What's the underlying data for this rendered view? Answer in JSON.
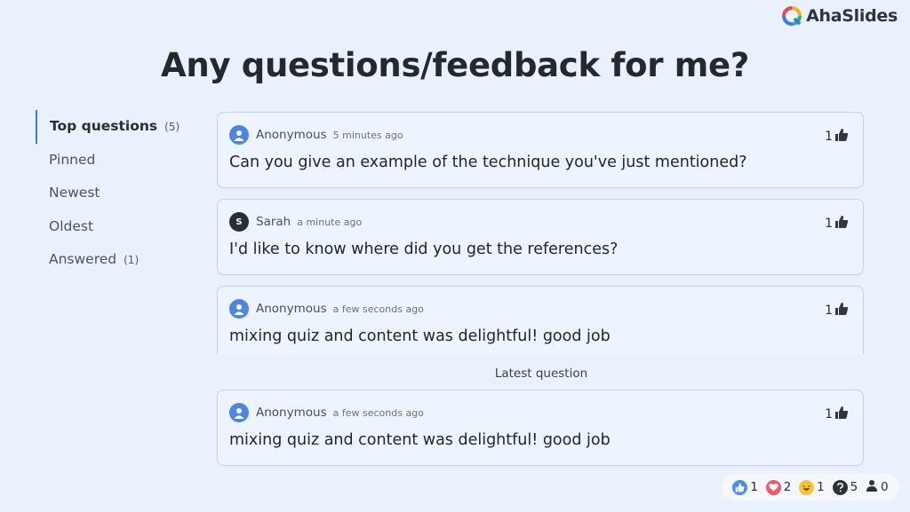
{
  "brand": {
    "name": "AhaSlides"
  },
  "title": "Any questions/feedback for me?",
  "sidebar": {
    "items": [
      {
        "label": "Top questions",
        "count": "(5)"
      },
      {
        "label": "Pinned",
        "count": ""
      },
      {
        "label": "Newest",
        "count": ""
      },
      {
        "label": "Oldest",
        "count": ""
      },
      {
        "label": "Answered",
        "count": "(1)"
      }
    ]
  },
  "questions": [
    {
      "author": "Anonymous",
      "time": "5 minutes ago",
      "text": "Can you give an example of the technique you've just mentioned?",
      "likes": "1",
      "avatar": "anonymous-avatar-icon"
    },
    {
      "author": "Sarah",
      "time": "a minute ago",
      "text": "I'd like to know where did you get the references?",
      "likes": "1",
      "avatar_letter": "S"
    },
    {
      "author": "Anonymous",
      "time": "a few seconds ago",
      "text": "mixing quiz and content was delightful! good job",
      "likes": "1",
      "avatar": "anonymous-avatar-icon"
    }
  ],
  "latest": {
    "label": "Latest question",
    "author": "Anonymous",
    "time": "a few seconds ago",
    "text": "mixing quiz and content was delightful! good job",
    "likes": "1"
  },
  "reactions": [
    {
      "icon": "thumbs-up-reaction-icon",
      "count": "1"
    },
    {
      "icon": "heart-reaction-icon",
      "count": "2"
    },
    {
      "icon": "laughing-face-reaction-icon",
      "count": "1"
    },
    {
      "icon": "question-mark-icon",
      "count": "5"
    },
    {
      "icon": "audience-user-icon",
      "count": "0"
    }
  ],
  "colors": {
    "accent": "#3a7be3",
    "background": "#e9f1fc",
    "card": "#eef4fd"
  }
}
